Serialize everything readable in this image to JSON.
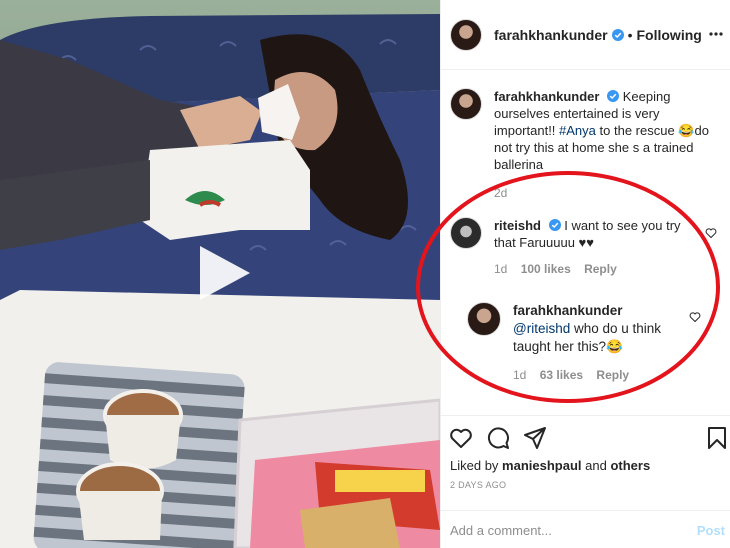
{
  "post": {
    "author": "farahkhankunder",
    "follow_status": "Following",
    "separator": "•"
  },
  "caption": {
    "author": "farahkhankunder",
    "text_before": "Keeping ourselves entertained is very important!! ",
    "hashtag": "#Anya",
    "text_after": " to the rescue 😂do not try this at home she s a trained ballerina",
    "age": "2d"
  },
  "comments": [
    {
      "author": "riteishd",
      "text": "I want to see you try that Faruuuuu ♥♥",
      "age": "1d",
      "likes": "100 likes",
      "reply_label": "Reply"
    }
  ],
  "replies": [
    {
      "author": "farahkhankunder",
      "mention": "@riteishd",
      "text": " who do u think taught her this?😂",
      "age": "1d",
      "likes": "63 likes",
      "reply_label": "Reply"
    }
  ],
  "likes_summary": {
    "prefix": "Liked by ",
    "user": "manieshpaul",
    "joiner": " and ",
    "others": "others"
  },
  "timestamp": "2 DAYS AGO",
  "comment_input": {
    "placeholder": "Add a comment...",
    "post_label": "Post"
  },
  "icons": {
    "verified": "verified-badge-icon",
    "more": "more-options-icon",
    "like": "heart-icon",
    "comment": "comment-bubble-icon",
    "share": "paper-plane-icon",
    "save": "bookmark-icon",
    "play": "play-icon"
  },
  "colors": {
    "verified_blue": "#3897f0",
    "link_blue": "#00376b",
    "highlight_red": "#e3141c",
    "muted_text": "#8e8e8e",
    "post_button": "#b2dffc"
  }
}
